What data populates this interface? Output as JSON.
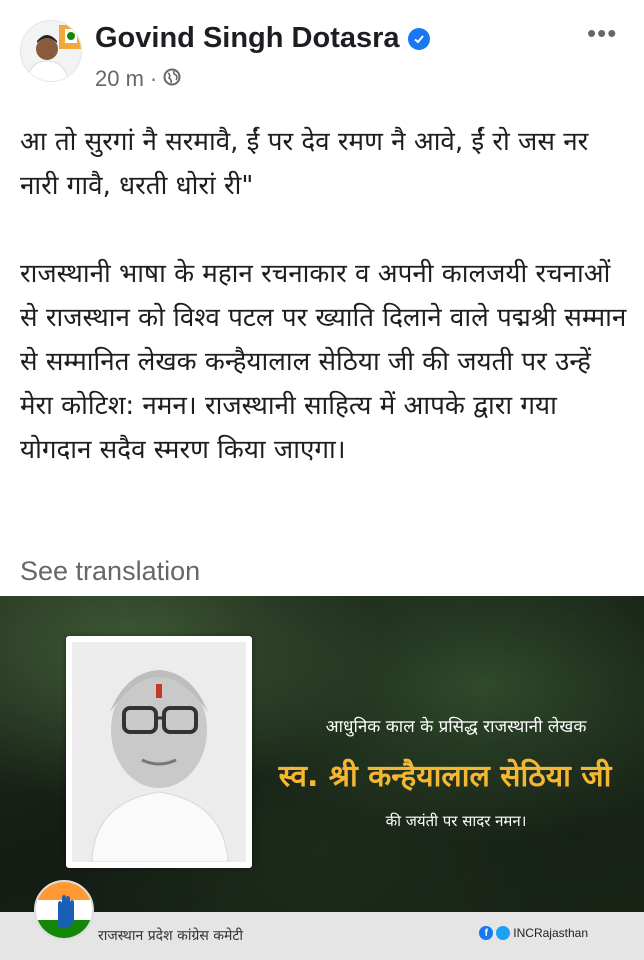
{
  "post": {
    "author": "Govind Singh Dotasra",
    "time": "20 m",
    "separator": "·",
    "paragraphs": [
      "आ तो सुरगां नै सरमावै, ईं पर देव रमण नै आवे, ईं रो जस नर नारी गावै, धरती धोरां री\"",
      "राजस्थानी भाषा के महान रचनाकार व अपनी कालजयी रचनाओं से राजस्थान को विश्व पटल पर ख्याति दिलाने वाले पद्मश्री सम्मान से सम्मानित लेखक कन्हैयालाल सेठिया जी की जयती पर उन्हें मेरा कोटिश: नमन। राजस्थानी साहित्य में आपके द्वारा गया योगदान सदैव स्मरण किया जाएगा।"
    ],
    "see_translation": "See translation"
  },
  "poster": {
    "line1": "आधुनिक काल के प्रसिद्ध राजस्थानी लेखक",
    "line2": "स्व. श्री कन्हैयालाल सेठिया जी",
    "line3": "की जयंती पर सादर नमन।",
    "org_name": "राजस्थान प्रदेश कांग्रेस कमेटी",
    "social_handle": "INCRajasthan"
  },
  "icons": {
    "verified": "verified-badge-icon",
    "privacy": "globe-icon",
    "menu": "more-options-icon"
  },
  "colors": {
    "link_blue": "#1877f2",
    "muted_text": "#65676b",
    "poster_title": "#f5b731"
  }
}
